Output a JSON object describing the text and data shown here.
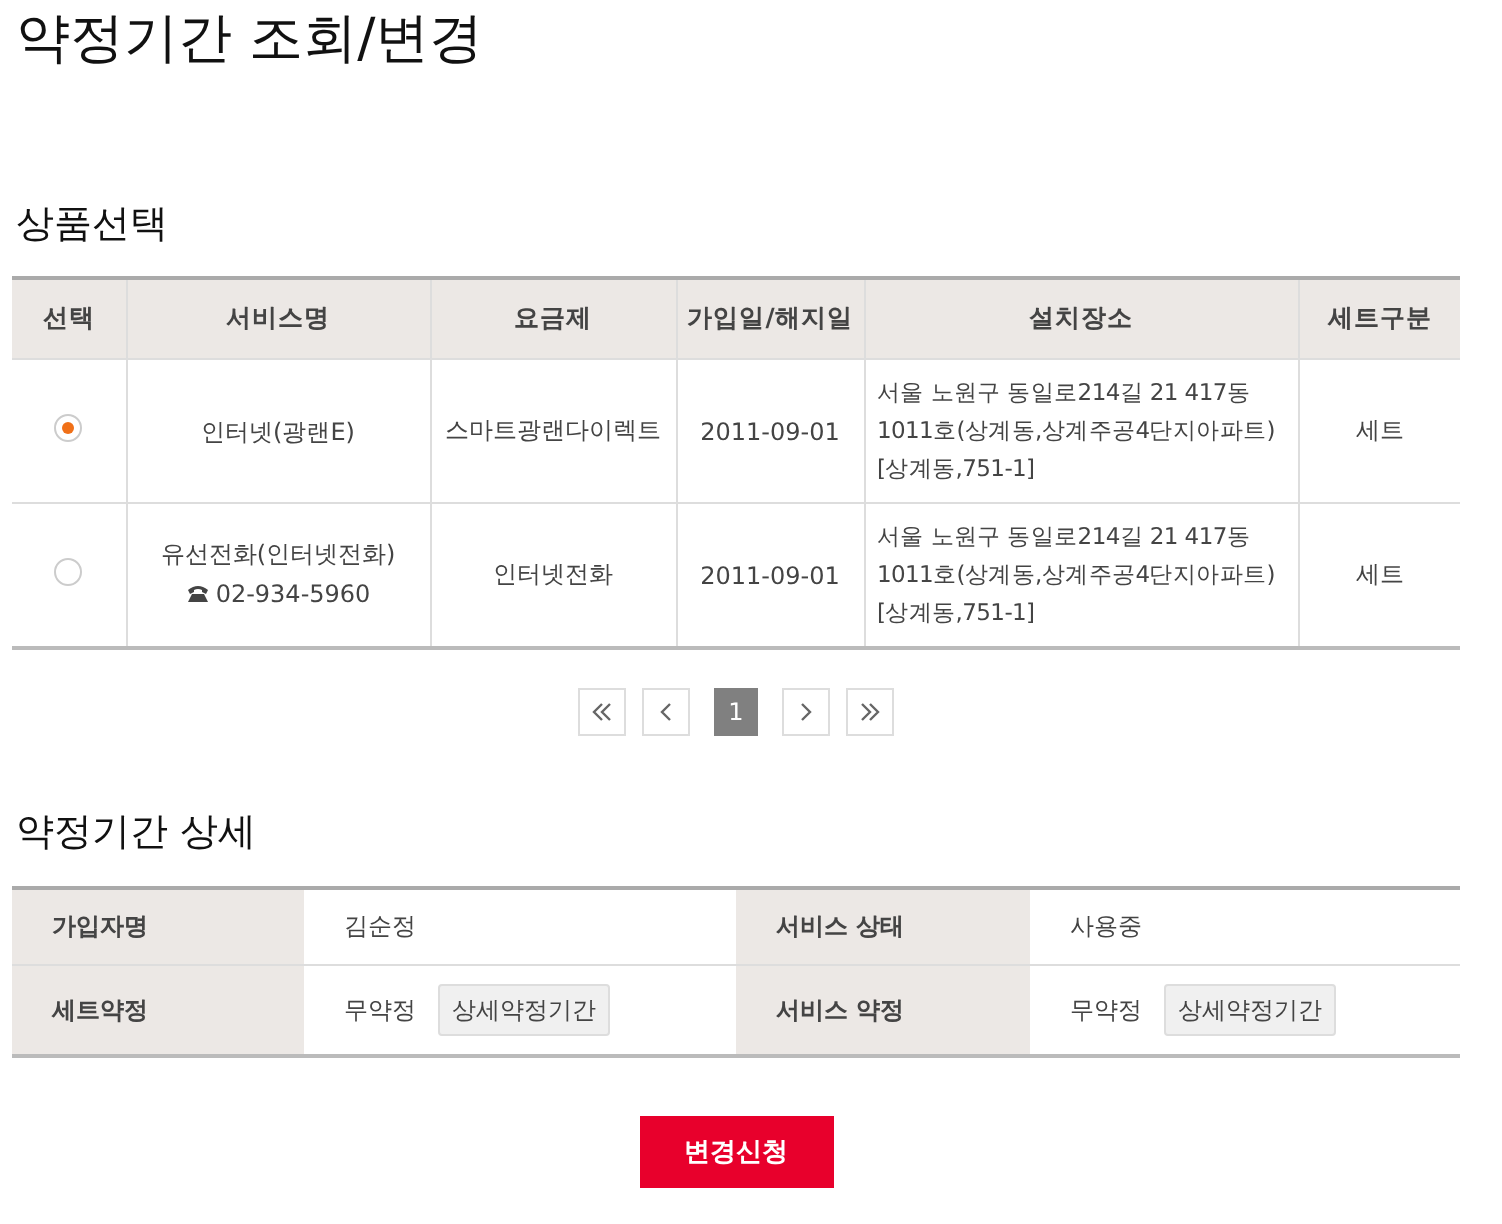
{
  "page_title": "약정기간 조회/변경",
  "product_section": {
    "title": "상품선택",
    "columns": [
      "선택",
      "서비스명",
      "요금제",
      "가입일/해지일",
      "설치장소",
      "세트구분"
    ],
    "rows": [
      {
        "selected": true,
        "service": "인터넷(광랜E)",
        "plan": "스마트광랜다이렉트",
        "date": "2011-09-01",
        "location": "서울 노원구 동일로214길 21 417동 1011호(상계동,상계주공4단지아파트) [상계동,751-1]",
        "set_type": "세트"
      },
      {
        "selected": false,
        "service": "유선전화(인터넷전화)",
        "phone": "02-934-5960",
        "plan": "인터넷전화",
        "date": "2011-09-01",
        "location": "서울 노원구 동일로214길 21 417동 1011호(상계동,상계주공4단지아파트) [상계동,751-1]",
        "set_type": "세트"
      }
    ]
  },
  "pagination": {
    "pages": [
      {
        "label": "1",
        "selected": true
      }
    ]
  },
  "detail_section": {
    "title": "약정기간 상세",
    "fields": [
      {
        "label": "가입자명",
        "value": "김순정"
      },
      {
        "label": "서비스 상태",
        "value": "사용중"
      },
      {
        "label": "세트약정",
        "value": "무약정",
        "button": "상세약정기간"
      },
      {
        "label": "서비스 약정",
        "value": "무약정",
        "button": "상세약정기간"
      }
    ]
  },
  "submit_button": "변경신청"
}
